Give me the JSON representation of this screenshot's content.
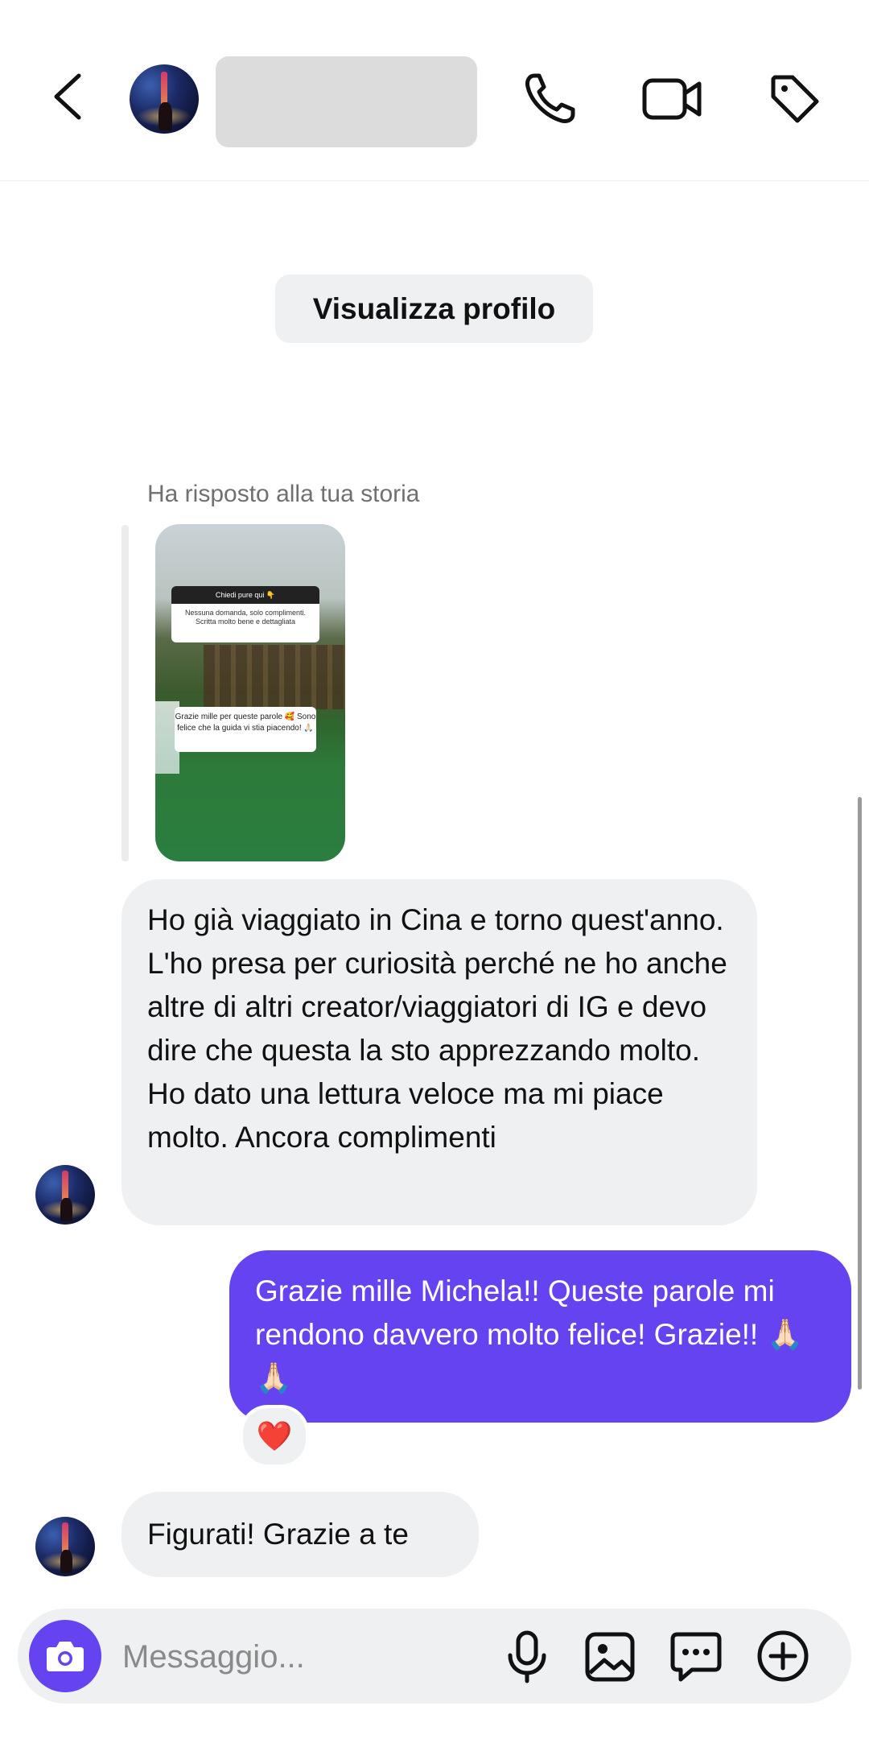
{
  "header": {
    "icons": [
      "back-arrow-icon",
      "phone-icon",
      "video-camera-icon",
      "tag-icon"
    ]
  },
  "profile_button_label": "Visualizza profilo",
  "story": {
    "label": "Ha risposto alla tua storia",
    "question_sticker": "Chiedi pure qui 👇",
    "answer_text": "Nessuna domanda, solo complimenti. Scritta molto bene e dettagliata",
    "reply_text": "Grazie mille per queste parole 🥰 Sono felice che la guida vi stia piacendo! 🙏🏻"
  },
  "messages": [
    {
      "from": "them",
      "text": "Ho già viaggiato in Cina e torno quest'anno. L'ho presa per curiosità perché ne ho anche altre di altri creator/viaggiatori di IG e devo dire che questa la sto apprezzando molto. Ho dato una lettura veloce ma mi piace molto. Ancora complimenti"
    },
    {
      "from": "me",
      "text": "Grazie mille Michela!! Queste parole mi rendono davvero molto felice! Grazie!! 🙏🏻🙏🏻",
      "reaction": "❤️"
    },
    {
      "from": "them",
      "text": "Figurati! Grazie a te"
    }
  ],
  "composer": {
    "placeholder": "Messaggio...",
    "icons": [
      "camera-icon",
      "microphone-icon",
      "image-icon",
      "sticker-chat-icon",
      "add-circle-icon"
    ]
  },
  "colors": {
    "accent": "#6543f0",
    "incoming_bubble": "#eff0f2",
    "background": "#ffffff"
  }
}
